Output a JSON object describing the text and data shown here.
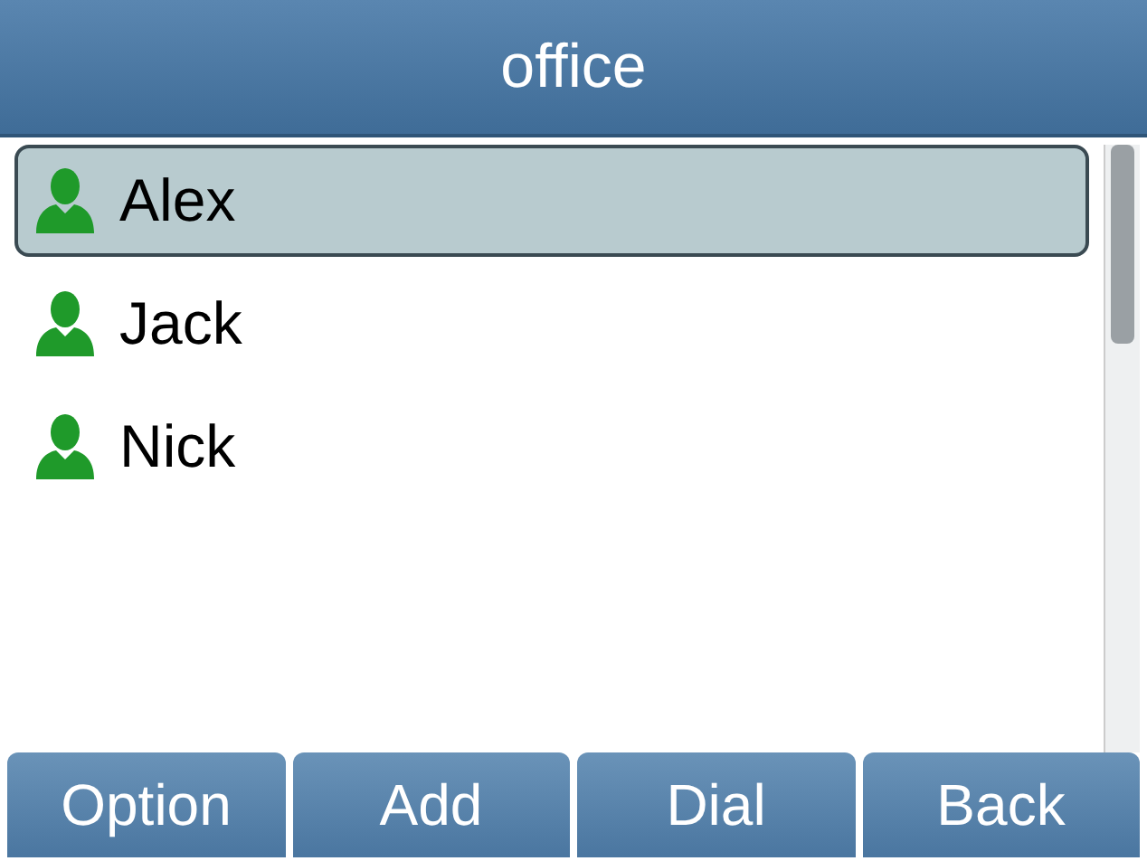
{
  "title": "office",
  "contacts": [
    {
      "name": "Alex",
      "selected": true
    },
    {
      "name": "Jack",
      "selected": false
    },
    {
      "name": "Nick",
      "selected": false
    }
  ],
  "softkeys": [
    "Option",
    "Add",
    "Dial",
    "Back"
  ]
}
